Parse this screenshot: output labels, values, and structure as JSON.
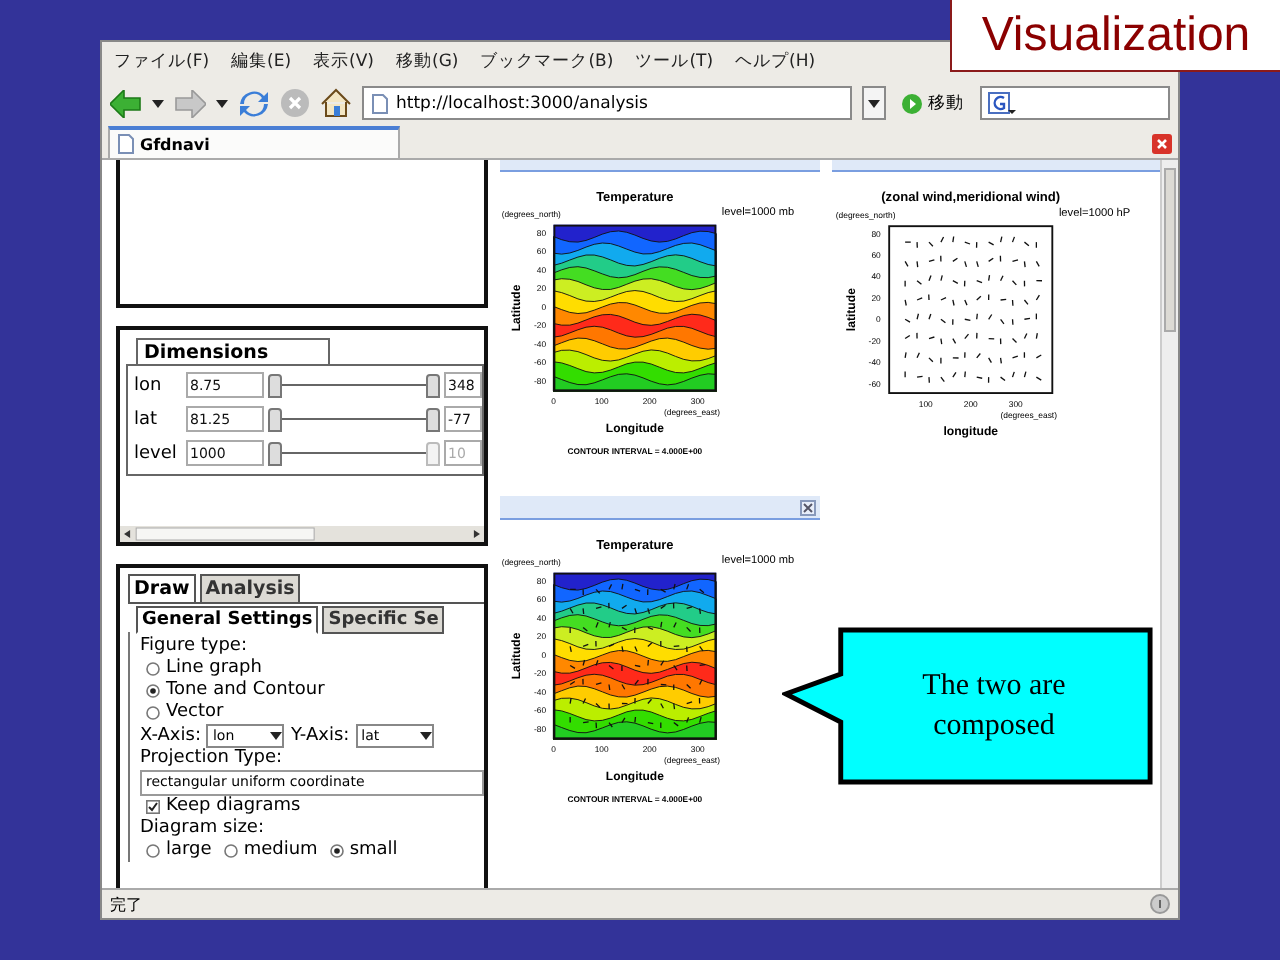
{
  "slide": {
    "title": "Visualization"
  },
  "browser": {
    "menu": [
      "ファイル(F)",
      "編集(E)",
      "表示(V)",
      "移動(G)",
      "ブックマーク(B)",
      "ツール(T)",
      "ヘルプ(H)"
    ],
    "url": "http://localhost:3000/analysis",
    "go_label": "移動",
    "tabs": [
      {
        "label": "Gfdnavi",
        "selected": true
      }
    ],
    "status": "完了"
  },
  "dimensions": {
    "title": "Dimensions",
    "rows": [
      {
        "name": "lon",
        "from": "8.75",
        "to": "348",
        "disabled": false
      },
      {
        "name": "lat",
        "from": "81.25",
        "to": "-77",
        "disabled": false
      },
      {
        "name": "level",
        "from": "1000",
        "to": "10",
        "disabled": true
      }
    ]
  },
  "draw_panel": {
    "tabs": [
      {
        "label": "Draw",
        "selected": true
      },
      {
        "label": "Analysis",
        "selected": false
      }
    ],
    "subtabs": [
      {
        "label": "General Settings",
        "selected": true
      },
      {
        "label": "Specific Se",
        "selected": false
      }
    ],
    "figure_type_label": "Figure type:",
    "figure_types": [
      {
        "label": "Line graph",
        "selected": false
      },
      {
        "label": "Tone and Contour",
        "selected": true
      },
      {
        "label": "Vector",
        "selected": false
      }
    ],
    "x_axis": {
      "label": "X-Axis:",
      "value": "lon"
    },
    "y_axis": {
      "label": "Y-Axis:",
      "value": "lat"
    },
    "projection_label": "Projection Type:",
    "projection": "rectangular uniform coordinate",
    "keep_diagrams": {
      "label": "Keep diagrams",
      "checked": true
    },
    "size_label": "Diagram size:",
    "sizes": [
      {
        "label": "large",
        "selected": false
      },
      {
        "label": "medium",
        "selected": false
      },
      {
        "label": "small",
        "selected": true
      }
    ]
  },
  "plots": [
    {
      "kind": "contour",
      "title": "Temperature",
      "ylabel": "Latitude",
      "xlabel": "Longitude",
      "y_unit": "(degrees_north)",
      "x_unit": "(degrees_east)",
      "level": "level=1000 mb",
      "xticks": [
        "0",
        "100",
        "200",
        "300"
      ],
      "yticks": [
        "80",
        "60",
        "40",
        "20",
        "0",
        "-20",
        "-40",
        "-60",
        "-80"
      ],
      "note": "CONTOUR INTERVAL = 4.000E+00"
    },
    {
      "kind": "vector",
      "title": "(zonal wind,meridional wind)",
      "ylabel": "latitude",
      "xlabel": "longitude",
      "y_unit": "(degrees_north)",
      "x_unit": "(degrees_east)",
      "level": "level=1000 hP",
      "xticks": [
        "100",
        "200",
        "300"
      ],
      "yticks": [
        "80",
        "60",
        "40",
        "20",
        "0",
        "-20",
        "-40",
        "-60"
      ]
    },
    {
      "kind": "overlay",
      "title": "Temperature",
      "ylabel": "Latitude",
      "xlabel": "Longitude",
      "y_unit": "(degrees_north)",
      "x_unit": "(degrees_east)",
      "level": "level=1000 mb",
      "xticks": [
        "0",
        "100",
        "200",
        "300"
      ],
      "yticks": [
        "80",
        "60",
        "40",
        "20",
        "0",
        "-20",
        "-40",
        "-60",
        "-80"
      ],
      "note": "CONTOUR INTERVAL = 4.000E+00"
    }
  ],
  "callout": {
    "text": "The two are composed"
  }
}
